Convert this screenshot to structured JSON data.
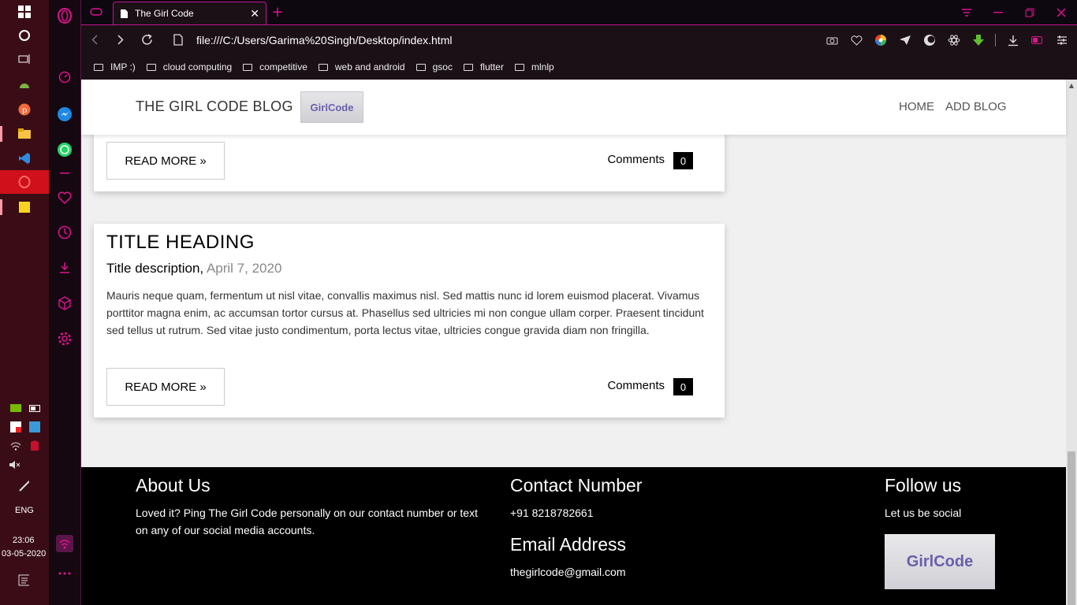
{
  "taskbar": {
    "time": "23:06",
    "date": "03-05-2020",
    "language": "ENG",
    "apps": [
      "windows-start-icon",
      "cortana-icon",
      "task-view-icon",
      "android-studio-icon",
      "postman-icon",
      "file-explorer-icon",
      "vscode-icon",
      "opera-icon",
      "sticky-notes-icon"
    ]
  },
  "browser": {
    "tab_title": "The Girl Code",
    "url": "file:///C:/Users/Garima%20Singh/Desktop/index.html",
    "bookmarks": [
      "IMP :)",
      "cloud computing",
      "competitive",
      "web and android",
      "gsoc",
      "flutter",
      "mlnlp"
    ]
  },
  "site": {
    "title": "THE GIRL CODE BLOG",
    "logo_text": "GirlCode",
    "nav": [
      "HOME",
      "ADD BLOG"
    ]
  },
  "posts": [
    {
      "read_more": "READ MORE »",
      "comments_label": "Comments",
      "comments_count": "0"
    },
    {
      "title": "TITLE HEADING",
      "description": "Title description,",
      "date": "April 7, 2020",
      "body": "Mauris neque quam, fermentum ut nisl vitae, convallis maximus nisl. Sed mattis nunc id lorem euismod placerat. Vivamus porttitor magna enim, ac accumsan tortor cursus at. Phasellus sed ultricies mi non congue ullam corper. Praesent tincidunt sed tellus ut rutrum. Sed vitae justo condimentum, porta lectus vitae, ultricies congue gravida diam non fringilla.",
      "read_more": "READ MORE »",
      "comments_label": "Comments",
      "comments_count": "0"
    }
  ],
  "footer": {
    "about_heading": "About Us",
    "about_text": "Loved it? Ping The Girl Code personally on our contact number or text on any of our social media accounts.",
    "contact_heading": "Contact Number",
    "contact_value": "+91 8218782661",
    "email_heading": "Email Address",
    "email_value": "thegirlcode@gmail.com",
    "follow_heading": "Follow us",
    "follow_text": "Let us be social",
    "logo_text": "GirlCode"
  },
  "colors": {
    "opera_accent": "#e0138f",
    "taskbar_bg": "#3a0d16",
    "page_bg": "#f0f0f0",
    "footer_bg": "#000000"
  }
}
